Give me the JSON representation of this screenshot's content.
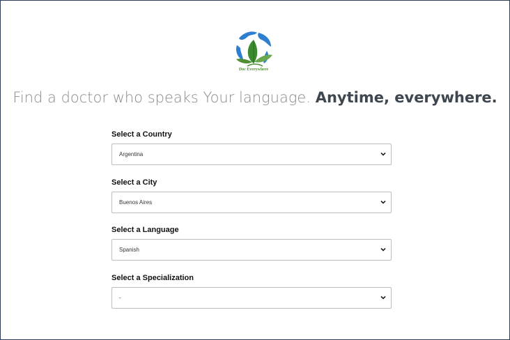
{
  "logo": {
    "text": "Doc Everywhere",
    "icon": "globe-leaves-logo"
  },
  "headline": {
    "light": "Find a doctor who speaks Your language.",
    "bold": "Anytime, everywhere."
  },
  "form": {
    "country": {
      "label": "Select a Country",
      "value": "Argentina"
    },
    "city": {
      "label": "Select a City",
      "value": "Buenos Aires"
    },
    "language": {
      "label": "Select a Language",
      "value": "Spanish"
    },
    "specialization": {
      "label": "Select a Specialization",
      "value": "-"
    }
  },
  "icons": {
    "dropdown": "chevron-down-icon"
  },
  "colors": {
    "brand_green": "#4e8f34",
    "brand_blue": "#2f7fd0",
    "headline_bold": "#3e4650"
  }
}
